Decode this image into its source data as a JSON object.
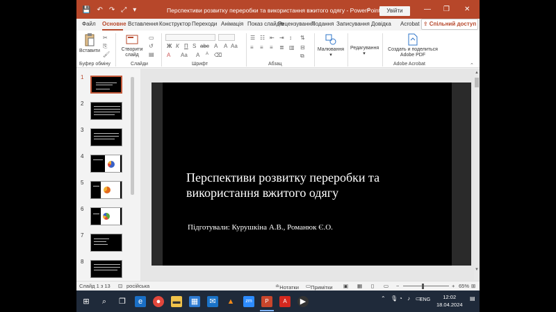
{
  "window": {
    "title": "Перспективи розвитку переробки та використання вжитого одягу  -  PowerPoint",
    "signin_label": "Увійти",
    "minimize": "—",
    "maximize": "❐",
    "close": "✕"
  },
  "qat": [
    "💾",
    "↶",
    "↷",
    "⤢",
    "▾"
  ],
  "tabs": [
    {
      "label": "Файл"
    },
    {
      "label": "Основне",
      "active": true
    },
    {
      "label": "Вставлення"
    },
    {
      "label": "Конструктор"
    },
    {
      "label": "Переходи"
    },
    {
      "label": "Анімація"
    },
    {
      "label": "Показ слайдів"
    },
    {
      "label": "Рецензування"
    },
    {
      "label": "Подання"
    },
    {
      "label": "Записування"
    },
    {
      "label": "Довідка"
    },
    {
      "label": "Acrobat"
    }
  ],
  "share_label": "Спільний доступ",
  "ribbon": {
    "groups": {
      "clipboard": "Буфер обміну",
      "slides": "Слайди",
      "font": "Шрифт",
      "paragraph": "Абзац",
      "adobe": "Adobe Acrobat"
    },
    "buttons": {
      "paste": "Вставити",
      "new_slide_l1": "Створити",
      "new_slide_l2": "слайд",
      "drawing": "Малювання",
      "editing": "Редагування",
      "adobe_l1": "Создать и поделиться",
      "adobe_l2": "Adobe PDF"
    },
    "font_tools": [
      "Ж",
      "К",
      "П",
      "S",
      "abc",
      "A",
      "A",
      "Aa"
    ],
    "font_tools2": [
      "A",
      "Аа",
      "A",
      "A"
    ]
  },
  "slides": [
    {
      "num": "1",
      "type": "title",
      "selected": true
    },
    {
      "num": "2",
      "type": "text"
    },
    {
      "num": "3",
      "type": "text"
    },
    {
      "num": "4",
      "type": "pie"
    },
    {
      "num": "5",
      "type": "pie2"
    },
    {
      "num": "6",
      "type": "pie3"
    },
    {
      "num": "7",
      "type": "text"
    },
    {
      "num": "8",
      "type": "text"
    }
  ],
  "current_slide": {
    "title": "Перспективи розвитку переробки та використання вжитого одягу",
    "subtitle": "Підготували: Курушкіна А.В., Романюк Є.О."
  },
  "status": {
    "slide_counter": "Слайд 1 з 13",
    "language": "російська",
    "notes": "Нотатки",
    "comments": "Примітки",
    "zoom": "65%"
  },
  "taskbar": {
    "lang": "ENG",
    "time": "12:02",
    "date": "18.04.2024"
  },
  "colors": {
    "accent": "#b7472a"
  }
}
